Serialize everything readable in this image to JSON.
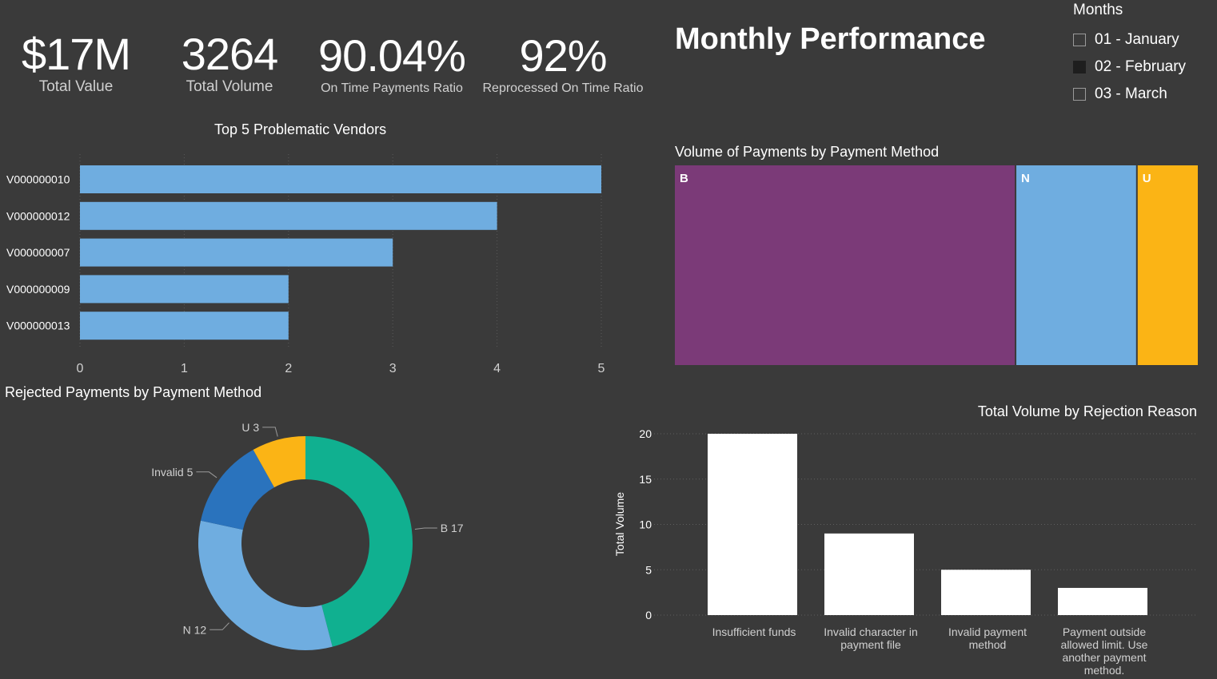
{
  "kpis": [
    {
      "value": "$17M",
      "label": "Total Value"
    },
    {
      "value": "3264",
      "label": "Total Volume"
    },
    {
      "value": "90.04%",
      "label": "On Time Payments Ratio"
    },
    {
      "value": "92%",
      "label": "Reprocessed On Time Ratio"
    }
  ],
  "page_title": "Monthly Performance",
  "slicer": {
    "header": "Months",
    "options": [
      {
        "label": "01 - January",
        "checked": false
      },
      {
        "label": "02 - February",
        "checked": true
      },
      {
        "label": "03 - March",
        "checked": false
      }
    ]
  },
  "chart_data": [
    {
      "type": "bar",
      "orientation": "horizontal",
      "title": "Top 5 Problematic Vendors",
      "categories": [
        "V000000010",
        "V000000012",
        "V000000007",
        "V000000009",
        "V000000013"
      ],
      "values": [
        5,
        4,
        3,
        2,
        2
      ],
      "xlim": [
        0,
        5
      ],
      "xticks": [
        "0",
        "1",
        "2",
        "3",
        "4",
        "5"
      ],
      "color": "#6fade0",
      "grid": true
    },
    {
      "type": "treemap",
      "title": "Volume of Payments by Payment Method",
      "items": [
        {
          "label": "B",
          "share": 0.653,
          "color": "#7b3a78"
        },
        {
          "label": "N",
          "share": 0.232,
          "color": "#6fade0"
        },
        {
          "label": "U",
          "share": 0.115,
          "color": "#fbb415"
        }
      ]
    },
    {
      "type": "pie",
      "subtype": "donut",
      "title": "Rejected Payments by Payment Method",
      "slices": [
        {
          "label": "B",
          "value": 17,
          "display": "B 17",
          "color": "#10b090"
        },
        {
          "label": "N",
          "value": 12,
          "display": "N 12",
          "color": "#6fade0"
        },
        {
          "label": "Invalid",
          "value": 5,
          "display": "Invalid 5",
          "color": "#2a73bd"
        },
        {
          "label": "U",
          "value": 3,
          "display": "U 3",
          "color": "#fbb415"
        }
      ]
    },
    {
      "type": "bar",
      "orientation": "vertical",
      "title": "Total Volume by Rejection Reason",
      "ylabel": "Total Volume",
      "categories": [
        [
          "Insufficient funds"
        ],
        [
          "Invalid character in",
          "payment file"
        ],
        [
          "Invalid payment",
          "method"
        ],
        [
          "Payment outside",
          "allowed limit. Use",
          "another payment",
          "method."
        ]
      ],
      "values": [
        20,
        9,
        5,
        3
      ],
      "ylim": [
        0,
        20
      ],
      "yticks": [
        "0",
        "5",
        "10",
        "15",
        "20"
      ],
      "color": "#ffffff",
      "grid": true
    }
  ]
}
